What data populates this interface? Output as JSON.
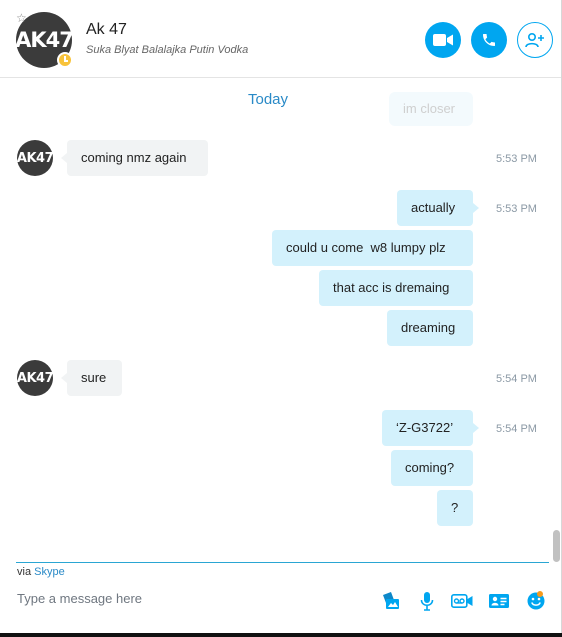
{
  "header": {
    "contact_name": "Ak 47",
    "mood": "Suka Blyat Balalajka Putin Vodka",
    "avatar_text": "AK47",
    "buttons": {
      "video": "video-call",
      "audio": "audio-call",
      "add": "add-people"
    }
  },
  "conversation": {
    "faded_text": "im closer",
    "day_separator": "Today",
    "avatar_text": "AK47",
    "messages": [
      {
        "text": "coming nmz again",
        "time": "5:53 PM"
      },
      {
        "text": "actually",
        "time": "5:53 PM"
      },
      {
        "text": "could u come  w8 lumpy plz"
      },
      {
        "text": "that acc is dremaing"
      },
      {
        "text": "dreaming"
      },
      {
        "text": "sure",
        "time": "5:54 PM"
      },
      {
        "text": "‘Z-G3722’",
        "time": "5:54 PM"
      },
      {
        "text": "coming?"
      },
      {
        "text": "?"
      }
    ]
  },
  "footer": {
    "via_prefix": "via",
    "via_link": "Skype",
    "placeholder": "Type a message here",
    "icons": [
      "send-image-icon",
      "microphone-icon",
      "video-message-icon",
      "contact-card-icon",
      "emoji-icon"
    ]
  },
  "colors": {
    "accent": "#00a6f0",
    "incoming_bubble": "#f1f3f4",
    "outgoing_bubble": "#d3f1fc",
    "link": "#2a8ac7"
  }
}
